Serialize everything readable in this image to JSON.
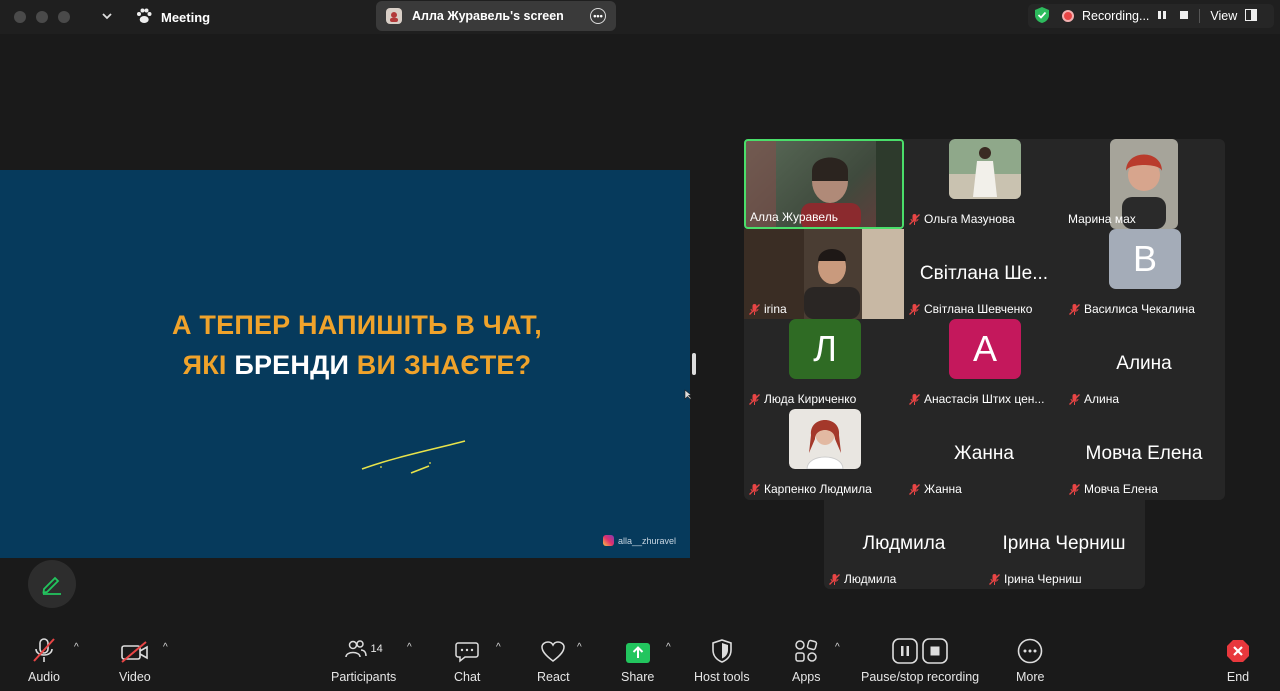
{
  "titlebar": {
    "app_name": "Meeting",
    "share_label": "Алла Журавель's screen",
    "recording_label": "Recording...",
    "view_label": "View"
  },
  "slide": {
    "line1": "А ТЕПЕР НАПИШІТЬ В ЧАТ,",
    "line2_a": "ЯКІ ",
    "line2_b": "БРЕНДИ",
    "line2_c": " ВИ ЗНАЄТЕ?",
    "handle": "alla__zhuravel"
  },
  "participants": [
    {
      "name": "Алла Журавель",
      "type": "video",
      "muted": false,
      "active": true
    },
    {
      "name": "Ольга Мазунова",
      "type": "photo",
      "muted": true
    },
    {
      "name": "Марина мах",
      "type": "photo",
      "muted": false
    },
    {
      "name": "irina",
      "type": "video",
      "muted": true
    },
    {
      "name": "Світлана Шевченко",
      "type": "text",
      "display": "Світлана Ше...",
      "muted": true
    },
    {
      "name": "Василиса Чекалина",
      "type": "letter",
      "letter": "В",
      "muted": true
    },
    {
      "name": "Люда Кириченко",
      "type": "letter",
      "letter": "Л",
      "muted": true
    },
    {
      "name": "Анастасія Штих цен...",
      "type": "letter",
      "letter": "А",
      "muted": true
    },
    {
      "name": "Алина",
      "type": "text",
      "display": "Алина",
      "muted": true
    },
    {
      "name": "Карпенко Людмила",
      "type": "photo",
      "muted": true
    },
    {
      "name": "Жанна",
      "type": "text",
      "display": "Жанна",
      "muted": true
    },
    {
      "name": "Мовча Елена",
      "type": "text",
      "display": "Мовча Елена",
      "muted": true
    },
    {
      "name": "Людмила",
      "type": "text",
      "display": "Людмила",
      "muted": true
    },
    {
      "name": "Ірина Черниш",
      "type": "text",
      "display": "Ірина Черниш",
      "muted": true
    }
  ],
  "toolbar": {
    "audio": "Audio",
    "video": "Video",
    "participants": "Participants",
    "participants_count": "14",
    "chat": "Chat",
    "react": "React",
    "share": "Share",
    "host_tools": "Host tools",
    "apps": "Apps",
    "pause_stop": "Pause/stop recording",
    "more": "More",
    "end": "End"
  },
  "colors": {
    "slide_bg": "#063a5c",
    "slide_orange": "#f0a32b",
    "share_green": "#22c55e",
    "end_red": "#e8383d",
    "active_border": "#4ade6a"
  }
}
